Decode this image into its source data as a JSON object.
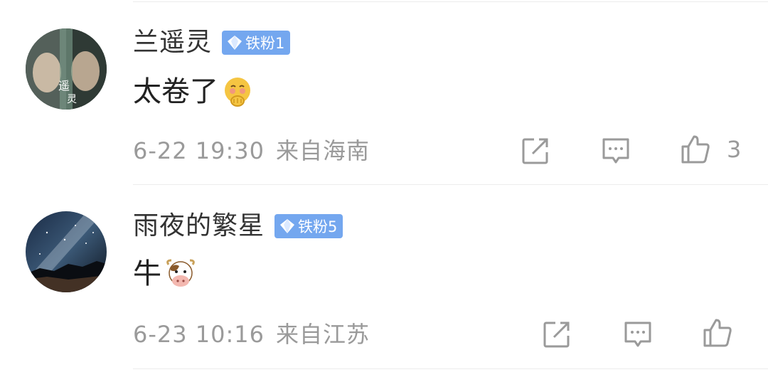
{
  "comments": [
    {
      "username": "兰遥灵",
      "badge": "铁粉1",
      "text": "太卷了",
      "emoji": "flushed-hands-emoji",
      "date": "6-22 19:30",
      "location": "来自海南",
      "like_count": "3"
    },
    {
      "username": "雨夜的繁星",
      "badge": "铁粉5",
      "text": "牛",
      "emoji": "cow-face-emoji",
      "date": "6-23 10:16",
      "location": "来自江苏",
      "like_count": ""
    }
  ],
  "colors": {
    "badge_bg": "#74a7ef",
    "meta_text": "#9a9a9a",
    "divider": "#ececec"
  }
}
